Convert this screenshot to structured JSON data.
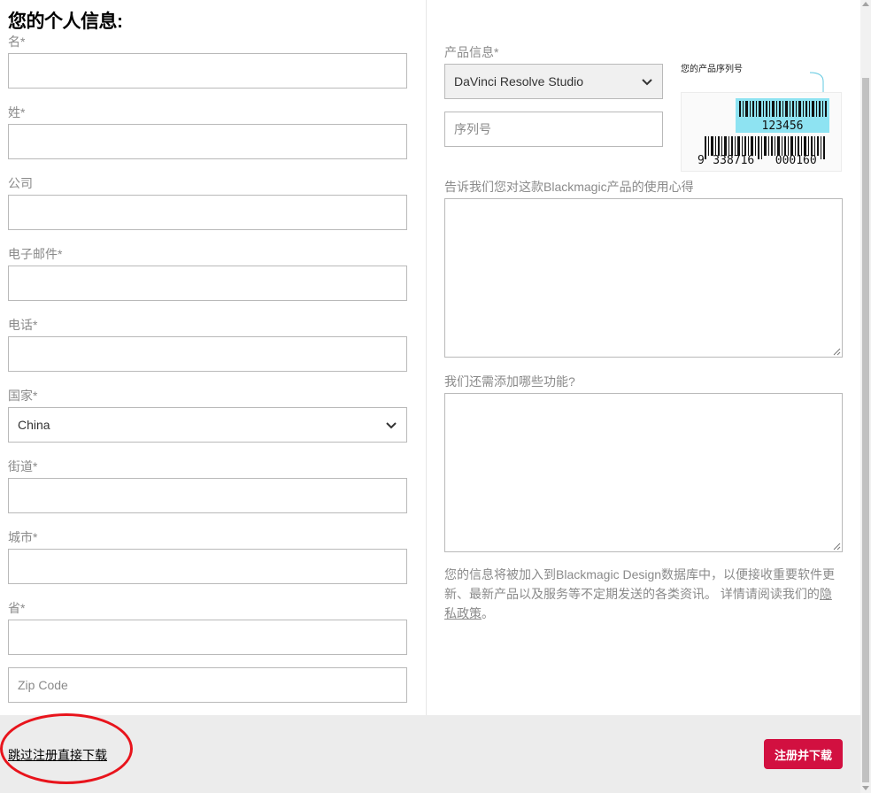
{
  "personal": {
    "title": "您的个人信息:",
    "first_name_label": "名*",
    "last_name_label": "姓*",
    "company_label": "公司",
    "email_label": "电子邮件*",
    "phone_label": "电话*",
    "country_label": "国家*",
    "country_value": "China",
    "street_label": "街道*",
    "city_label": "城市*",
    "province_label": "省*",
    "zip_placeholder": "Zip Code"
  },
  "product": {
    "label": "产品信息*",
    "selected": "DaVinci Resolve Studio",
    "serial_placeholder": "序列号",
    "serial_caption": "您的产品序列号",
    "barcode_short": "123456",
    "barcode_lead": "9",
    "barcode_long": "338716   000160",
    "feedback_label": "告诉我们您对这款Blackmagic产品的使用心得",
    "features_label": "我们还需添加哪些功能?",
    "notice_text": "您的信息将被加入到Blackmagic Design数据库中，以便接收重要软件更新、最新产品以及服务等不定期发送的各类资讯。 详情请阅读我们的",
    "privacy_link": "隐私政策",
    "notice_end": "。"
  },
  "footer": {
    "skip_link": "跳过注册直接下载",
    "submit_label": "注册并下载"
  },
  "colors": {
    "accent": "#d21040",
    "highlight_circle": "#e8141c",
    "barcode_label_bg": "#8ee3f2"
  }
}
